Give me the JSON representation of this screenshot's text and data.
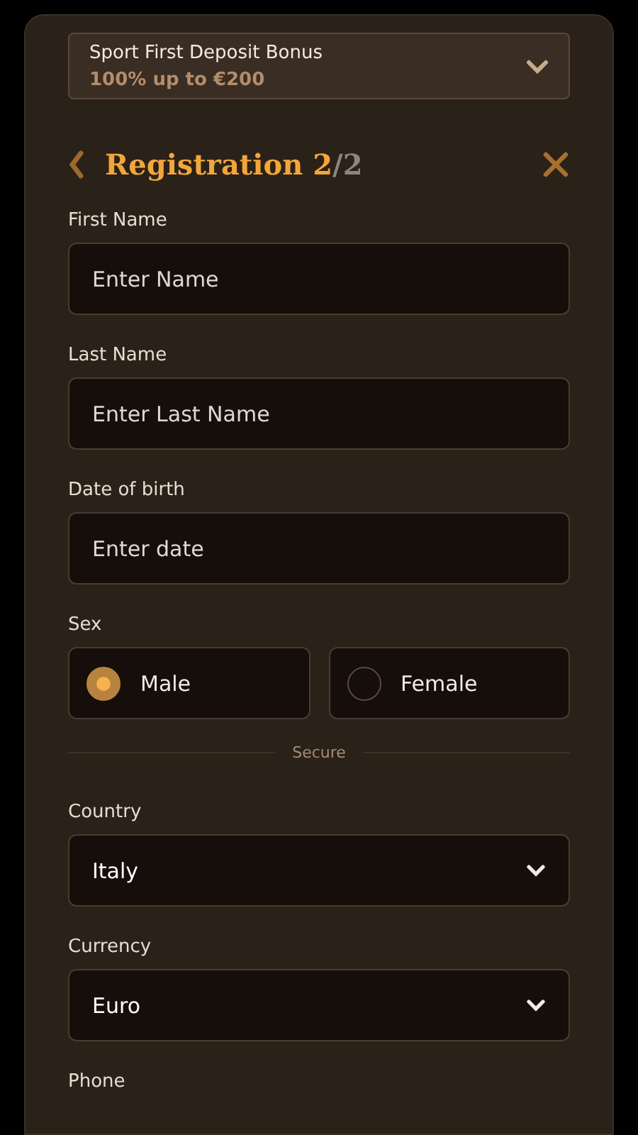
{
  "bonus": {
    "title": "Sport First Deposit Bonus",
    "subtitle": "100% up to €200",
    "expanded": false
  },
  "header": {
    "title": "Registration",
    "step": "2",
    "total": "/2"
  },
  "fields": [
    {
      "kind": "text",
      "label": "First Name",
      "placeholder": "Enter Name"
    },
    {
      "kind": "text",
      "label": "Last Name",
      "placeholder": "Enter Last Name"
    },
    {
      "kind": "text",
      "label": "Date of birth",
      "placeholder": "Enter date"
    },
    {
      "kind": "radio",
      "label": "Sex",
      "options": [
        {
          "label": "Male",
          "selected": true
        },
        {
          "label": "Female",
          "selected": false
        }
      ]
    },
    {
      "kind": "divider",
      "label": "Secure"
    },
    {
      "kind": "select",
      "label": "Country",
      "value": "Italy"
    },
    {
      "kind": "select",
      "label": "Currency",
      "value": "Euro"
    },
    {
      "kind": "cut",
      "label": "Phone"
    }
  ]
}
